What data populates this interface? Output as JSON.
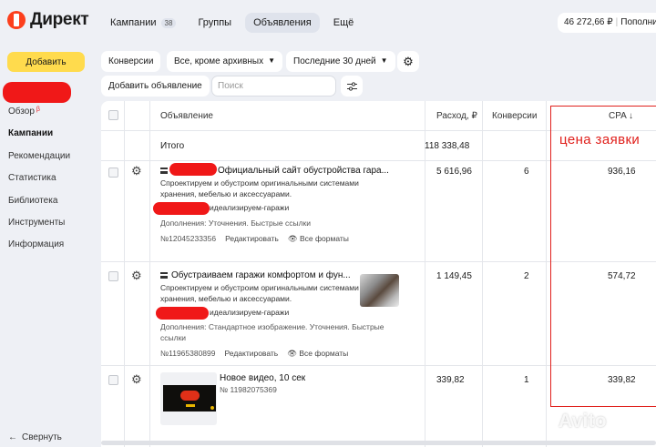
{
  "app": {
    "name": "Директ"
  },
  "topnav": {
    "tabs": [
      {
        "label": "Кампании",
        "badge": "38"
      },
      {
        "label": "Группы"
      },
      {
        "label": "Объявления"
      },
      {
        "label": "Ещё"
      }
    ]
  },
  "balance": {
    "amount": "46 272,66 ₽",
    "action": "Пополнить"
  },
  "sidebar": {
    "add_label": "Добавить",
    "items": [
      {
        "label": "Обзор",
        "badge": "β"
      },
      {
        "label": "Кампании"
      },
      {
        "label": "Рекомендации"
      },
      {
        "label": "Статистика"
      },
      {
        "label": "Библиотека"
      },
      {
        "label": "Инструменты"
      },
      {
        "label": "Информация"
      }
    ],
    "collapse_label": "Свернуть"
  },
  "filters": {
    "conversions": "Конверсии",
    "status": "Все, кроме архивных",
    "period": "Последние 30 дней",
    "add_ad": "Добавить объявление",
    "search_placeholder": "Поиск"
  },
  "table": {
    "headers": {
      "ad": "Объявление",
      "spend": "Расход, ₽",
      "conversions": "Конверсии",
      "cpa": "CPA ↓"
    },
    "total": {
      "label": "Итого",
      "spend": "118 338,48"
    },
    "rows": [
      {
        "title": "Официальный сайт обустройства гара...",
        "desc": "Спроектируем и обустроим оригинальными системами хранения, мебелью и аксессуарами.",
        "url": "идеализируем-гаражи",
        "extras": "Дополнения: Уточнения. Быстрые ссылки",
        "id": "№12045233356",
        "edit": "Редактировать",
        "formats": "Все форматы",
        "spend": "5 616,96",
        "conversions": "6",
        "cpa": "936,16"
      },
      {
        "title": "Обустраиваем гаражи комфортом и фун...",
        "desc": "Спроектируем и обустроим оригинальными системами хранения, мебелью и аксессуарами.",
        "url": "идеализируем-гаражи",
        "extras": "Дополнения: Стандартное изображение. Уточнения. Быстрые ссылки",
        "id": "№11965380899",
        "edit": "Редактировать",
        "formats": "Все форматы",
        "spend": "1 149,45",
        "conversions": "2",
        "cpa": "574,72"
      },
      {
        "title": "Новое видео, 10 сек",
        "id": "№ 11982075369",
        "spend": "339,82",
        "conversions": "1",
        "cpa": "339,82"
      }
    ]
  },
  "annotation": {
    "text": "цена заявки",
    "color": "#e0201c"
  },
  "watermark": "Avito",
  "colors": {
    "accent": "#ffdb4d",
    "redaction": "#f01818",
    "brand": "#fc3f1d"
  }
}
